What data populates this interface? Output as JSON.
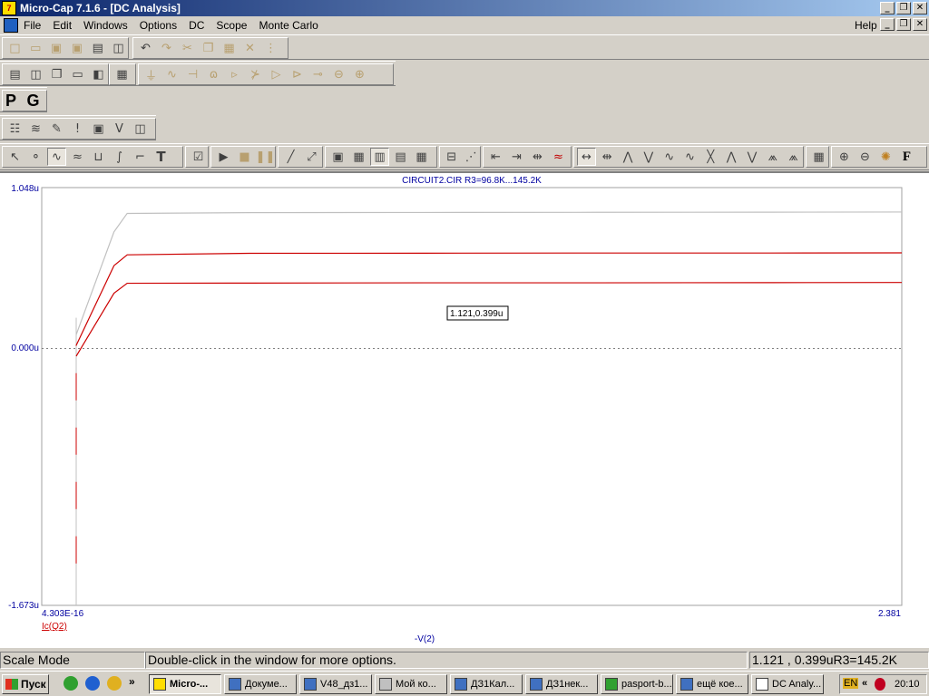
{
  "window": {
    "title": "Micro-Cap 7.1.6 - [DC Analysis]",
    "app_icon_text": "7",
    "minimize": "_",
    "restore": "❐",
    "close": "✕"
  },
  "menu": {
    "items": [
      "File",
      "Edit",
      "Windows",
      "Options",
      "DC",
      "Scope",
      "Monte Carlo"
    ],
    "help": "Help"
  },
  "toolbar_pg": {
    "p": "P",
    "g": "G"
  },
  "plot": {
    "caption": "CIRCUIT2.CIR R3=96.8K...145.2K",
    "y_top_label": "1.048u",
    "y_zero_label": "0.000u",
    "y_bottom_label": "-1.673u",
    "x_left_label": "4.303E-16",
    "x_right_label": "2.381",
    "y_expression": "Ic(Q2)",
    "x_expression": "-V(2)",
    "tooltip": "1.121,0.399u",
    "colors": {
      "axis_label": "#0000a0",
      "curve_red": "#cc0000",
      "curve_gray": "#c0c0c0",
      "y_expr": "#cc0000"
    }
  },
  "chart_data": {
    "type": "line",
    "xlabel": "-V(2)",
    "ylabel": "Ic(Q2)",
    "xlim": [
      0,
      2.381
    ],
    "ylim": [
      -1.673,
      1.048
    ],
    "y_unit": "u",
    "title": "CIRCUIT2.CIR R3=96.8K...145.2K",
    "grid": false,
    "series": [
      {
        "x": [
          0,
          0.109,
          0.147,
          0.5,
          1.0,
          1.5,
          2.0,
          2.381
        ],
        "y": [
          -0.05,
          0.36,
          0.425,
          0.426,
          0.428,
          0.428,
          0.429,
          0.43
        ]
      },
      {
        "x": [
          0,
          0.109,
          0.147,
          0.5,
          1.0,
          1.5,
          2.0,
          2.381
        ],
        "y": [
          0.02,
          0.54,
          0.61,
          0.62,
          0.621,
          0.622,
          0.622,
          0.623
        ]
      },
      {
        "x": [
          0,
          0.109,
          0.147,
          0.5,
          1.0,
          1.5,
          2.0,
          2.381
        ],
        "y": [
          0.09,
          0.76,
          0.88,
          0.885,
          0.886,
          0.887,
          0.888,
          0.889
        ]
      }
    ]
  },
  "status": {
    "mode": "Scale Mode",
    "hint": "Double-click in the window for more options.",
    "readout": "1.121 , 0.399uR3=145.2K"
  },
  "taskbar": {
    "start": "Пуск",
    "chevron": "»",
    "tasks": [
      "Micro-...",
      "Докуме...",
      "V48_дз1...",
      "Мой ко...",
      "ДЗ1Кал...",
      "ДЗ1нек...",
      "pasport-b...",
      "ещё кое...",
      "DC Analy..."
    ],
    "lang": "EN",
    "tray_chevron": "«",
    "clock": "20:10"
  }
}
